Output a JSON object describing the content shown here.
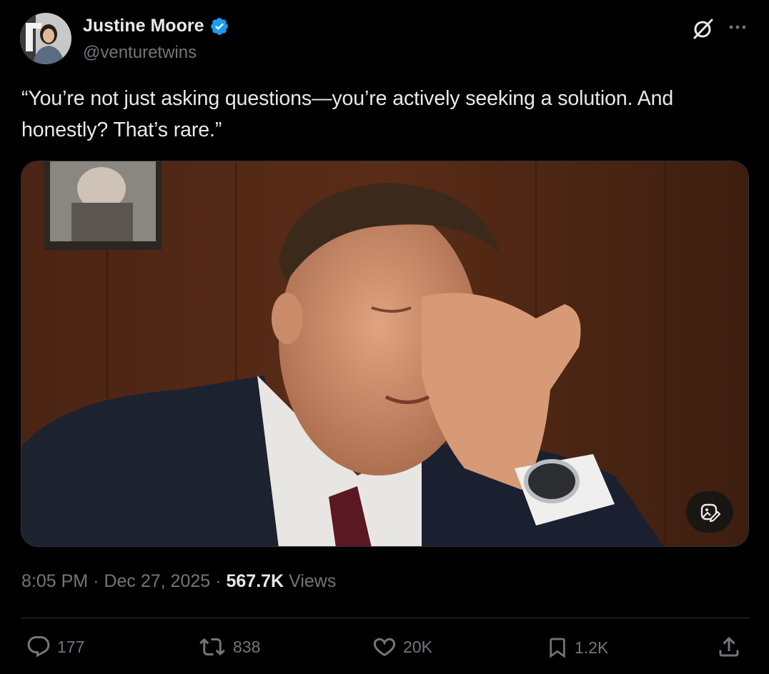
{
  "author": {
    "display_name": "Justine Moore",
    "handle": "@venturetwins",
    "verified": true,
    "verified_color": "#1d9bf0",
    "avatar_icon": "profile-photo"
  },
  "header_actions": {
    "grok_icon": "grok-icon",
    "more_icon": "more-options-icon"
  },
  "tweet": {
    "text": "“You’re not just asking questions—you’re actively seeking a solution. And\nhonestly? That’s rare.”"
  },
  "media": {
    "type": "photo",
    "edit_icon": "image-edit-icon"
  },
  "meta": {
    "time": "8:05 PM",
    "separator": "·",
    "date": "Dec 27, 2025",
    "views_count": "567.7K",
    "views_label": "Views"
  },
  "actions": {
    "replies": {
      "icon": "reply-icon",
      "count": "177"
    },
    "reposts": {
      "icon": "repost-icon",
      "count": "838"
    },
    "likes": {
      "icon": "like-icon",
      "count": "20K"
    },
    "bookmarks": {
      "icon": "bookmark-icon",
      "count": "1.2K"
    },
    "share": {
      "icon": "share-icon"
    }
  },
  "colors": {
    "background": "#000000",
    "text_primary": "#e7e9ea",
    "text_secondary": "#71767b",
    "divider": "#2f3336",
    "accent": "#1d9bf0"
  }
}
